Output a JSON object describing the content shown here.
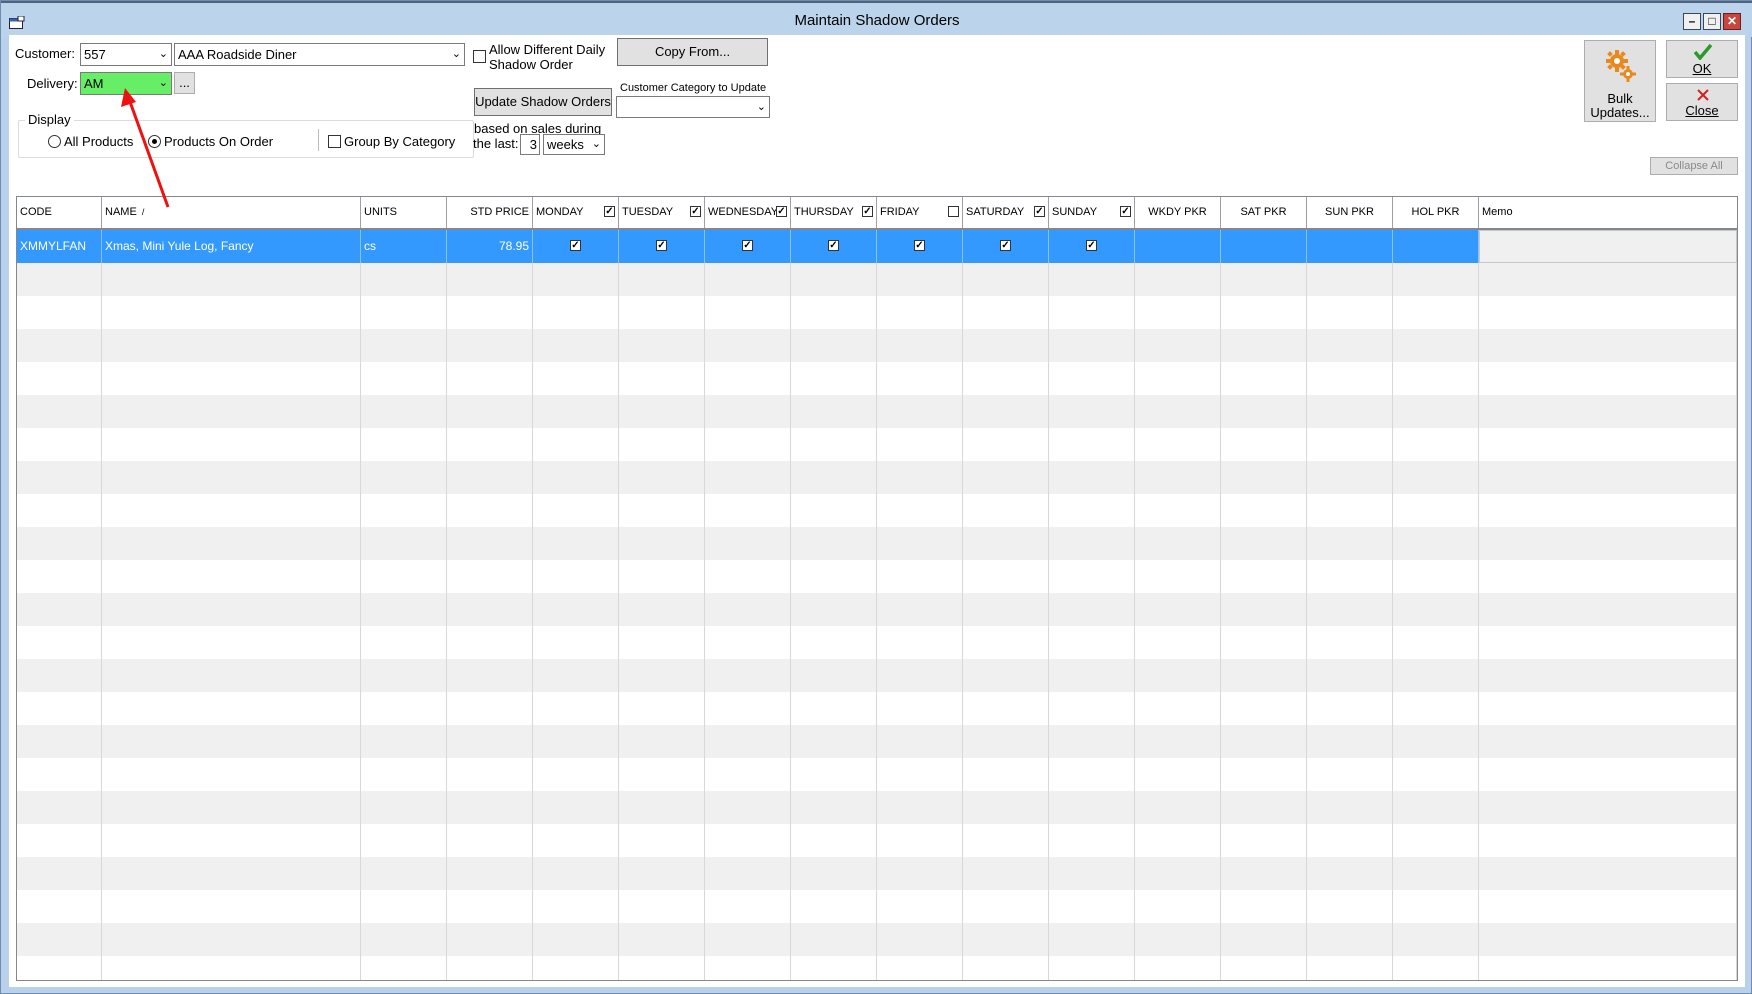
{
  "window": {
    "title": "Maintain Shadow Orders",
    "controls": [
      "–",
      "□",
      "✕"
    ]
  },
  "form": {
    "customer_label": "Customer:",
    "customer_code": "557",
    "customer_name": "AAA Roadside Diner",
    "delivery_label": "Delivery:",
    "delivery_value": "AM",
    "ellipsis": "...",
    "allow_diff_label": "Allow Different Daily Shadow Order",
    "copy_from": "Copy From...",
    "update_shadow": "Update Shadow Orders",
    "category_label": "Customer Category to Update",
    "category_value": "",
    "based_on": "based on sales during",
    "the_last": "the last:",
    "last_count": "3",
    "period": "weeks",
    "display_label": "Display",
    "radio_all": "All Products",
    "radio_on_order": "Products On Order",
    "group_by": "Group By Category",
    "bulk_updates_line1": "Bulk",
    "bulk_updates_line2": "Updates...",
    "ok": "OK",
    "close": "Close",
    "collapse_all": "Collapse All"
  },
  "grid": {
    "headers": {
      "code": "CODE",
      "name": "NAME",
      "sort_indicator": "/",
      "units": "UNITS",
      "std_price": "STD PRICE",
      "monday": "MONDAY",
      "tuesday": "TUESDAY",
      "wednesday": "WEDNESDAY",
      "thursday": "THURSDAY",
      "friday": "FRIDAY",
      "saturday": "SATURDAY",
      "sunday": "SUNDAY",
      "wkdy_pkr": "WKDY PKR",
      "sat_pkr": "SAT PKR",
      "sun_pkr": "SUN PKR",
      "hol_pkr": "HOL PKR",
      "memo": "Memo"
    },
    "header_checks": {
      "monday": true,
      "tuesday": true,
      "wednesday": true,
      "thursday": true,
      "friday": false,
      "saturday": true,
      "sunday": true
    },
    "rows": [
      {
        "code": "XMMYLFAN",
        "name": "Xmas, Mini Yule Log, Fancy",
        "units": "cs",
        "std_price": "78.95",
        "days": [
          true,
          true,
          true,
          true,
          true,
          true,
          true
        ]
      }
    ]
  },
  "colors": {
    "selection": "#3399ff",
    "delivery_bg": "#66ee66",
    "annotation_arrow": "#ee1111"
  }
}
